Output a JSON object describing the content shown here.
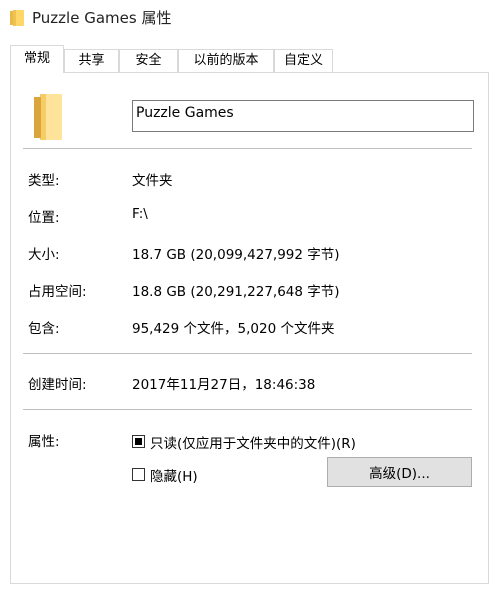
{
  "window": {
    "title": "Puzzle Games 属性"
  },
  "tabs": [
    {
      "label": "常规",
      "active": true
    },
    {
      "label": "共享",
      "active": false
    },
    {
      "label": "安全",
      "active": false
    },
    {
      "label": "以前的版本",
      "active": false
    },
    {
      "label": "自定义",
      "active": false
    }
  ],
  "general": {
    "name_value": "Puzzle Games",
    "type_label": "类型:",
    "type_value": "文件夹",
    "location_label": "位置:",
    "location_value": "F:\\",
    "size_label": "大小:",
    "size_value": "18.7 GB (20,099,427,992 字节)",
    "size_on_disk_label": "占用空间:",
    "size_on_disk_value": "18.8 GB (20,291,227,648 字节)",
    "contains_label": "包含:",
    "contains_value": "95,429 个文件，5,020 个文件夹",
    "created_label": "创建时间:",
    "created_value": "2017年11月27日，18:46:38",
    "attributes_label": "属性:",
    "readonly_label": "只读(仅应用于文件夹中的文件)(R)",
    "readonly_state": "indeterminate",
    "hidden_label": "隐藏(H)",
    "hidden_checked": false,
    "advanced_button_label": "高级(D)..."
  },
  "icons": {
    "title_icon": "folder-icon",
    "main_icon": "folder-icon"
  },
  "colors": {
    "folder_light": "#ffe39a",
    "folder_dark": "#e8b84a",
    "border": "#d9d9d9",
    "button_face": "#e1e1e1"
  }
}
